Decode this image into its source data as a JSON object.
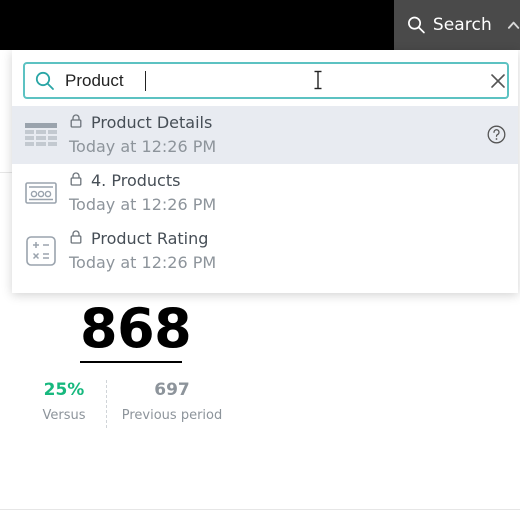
{
  "topbar": {
    "search_label": "Search",
    "search_icon": "magnifier-icon",
    "collapse_icon": "chevron-up-icon"
  },
  "search": {
    "value": "Product",
    "placeholder": "",
    "clear_icon": "close-icon"
  },
  "results": [
    {
      "title": "Product Details",
      "time": "Today at 12:26 PM",
      "type_icon": "table-icon",
      "locked": true,
      "active": true,
      "help_icon": "question-circle-icon"
    },
    {
      "title": "4. Products",
      "time": "Today at 12:26 PM",
      "type_icon": "kpi-display-icon",
      "locked": true,
      "active": false
    },
    {
      "title": "Product Rating",
      "time": "Today at 12:26 PM",
      "type_icon": "calculator-icon",
      "locked": true,
      "active": false
    }
  ],
  "kpi": {
    "value": "868",
    "change": "25%",
    "change_label": "Versus",
    "previous": "697",
    "previous_label": "Previous period"
  },
  "colors": {
    "accent": "#5cc2c2",
    "positive": "#17b87e",
    "active_row": "#e8ebf1",
    "topbar": "#000000",
    "search_toggle": "#4a4a4a"
  }
}
